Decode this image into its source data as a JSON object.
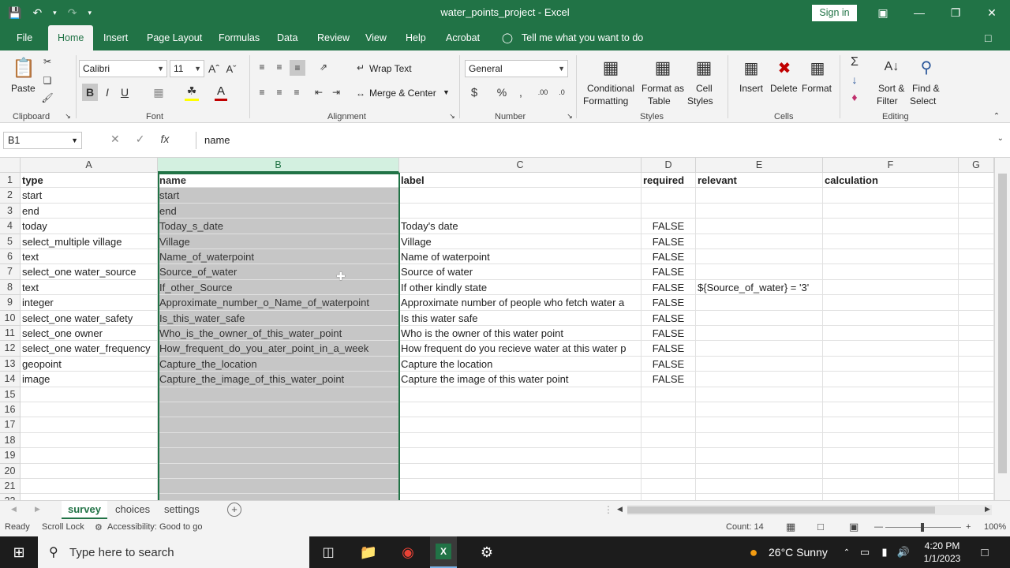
{
  "titlebar": {
    "document_title": "water_points_project  -  Excel",
    "sign_in": "Sign in"
  },
  "ribbon_tabs": [
    "File",
    "Home",
    "Insert",
    "Page Layout",
    "Formulas",
    "Data",
    "Review",
    "View",
    "Help",
    "Acrobat"
  ],
  "tell_me": "Tell me what you want to do",
  "ribbon": {
    "paste": "Paste",
    "font_name": "Calibri",
    "font_size": "11",
    "bold": "B",
    "italic": "I",
    "underline": "U",
    "wrap_text": "Wrap Text",
    "merge_center": "Merge & Center",
    "number_format": "General",
    "conditional_formatting": "Conditional",
    "conditional_formatting2": "Formatting",
    "format_as_table": "Format as",
    "format_as_table2": "Table",
    "cell_styles": "Cell",
    "cell_styles2": "Styles",
    "insert": "Insert",
    "delete": "Delete",
    "format": "Format",
    "sort_filter": "Sort &",
    "sort_filter2": "Filter",
    "find_select": "Find &",
    "find_select2": "Select",
    "groups": {
      "clipboard": "Clipboard",
      "font": "Font",
      "alignment": "Alignment",
      "number": "Number",
      "styles": "Styles",
      "cells": "Cells",
      "editing": "Editing"
    }
  },
  "formula_bar": {
    "name_box": "B1",
    "fx": "fx",
    "formula": "name"
  },
  "columns": [
    {
      "letter": "A"
    },
    {
      "letter": "B"
    },
    {
      "letter": "C"
    },
    {
      "letter": "D"
    },
    {
      "letter": "E"
    },
    {
      "letter": "F"
    },
    {
      "letter": "G"
    }
  ],
  "rows": [
    [
      "type",
      "name",
      "label",
      "required",
      "relevant",
      "calculation"
    ],
    [
      "start",
      "start",
      "",
      "",
      "",
      ""
    ],
    [
      "end",
      "end",
      "",
      "",
      "",
      ""
    ],
    [
      "today",
      "Today_s_date",
      "Today's date",
      "FALSE",
      "",
      ""
    ],
    [
      "select_multiple village",
      "Village",
      "Village",
      "FALSE",
      "",
      ""
    ],
    [
      "text",
      "Name_of_waterpoint",
      "Name of waterpoint",
      "FALSE",
      "",
      ""
    ],
    [
      "select_one water_source",
      "Source_of_water",
      "Source of water",
      "FALSE",
      "",
      ""
    ],
    [
      "text",
      "If_other_Source",
      "If other kindly state",
      "FALSE",
      "${Source_of_water} = '3'",
      ""
    ],
    [
      "integer",
      "Approximate_number_o_Name_of_waterpoint",
      "Approximate number of people who fetch water a",
      "FALSE",
      "",
      ""
    ],
    [
      "select_one water_safety",
      "Is_this_water_safe",
      "Is this water safe",
      "FALSE",
      "",
      ""
    ],
    [
      "select_one owner",
      "Who_is_the_owner_of_this_water_point",
      "Who is the owner of this water point",
      "FALSE",
      "",
      ""
    ],
    [
      "select_one water_frequency",
      "How_frequent_do_you_ater_point_in_a_week",
      "How frequent do you recieve water at this water p",
      "FALSE",
      "",
      ""
    ],
    [
      "geopoint",
      "Capture_the_location",
      "Capture the location",
      "FALSE",
      "",
      ""
    ],
    [
      "image",
      "Capture_the_image_of_this_water_point",
      "Capture the image of this water point",
      "FALSE",
      "",
      ""
    ],
    [
      "",
      "",
      "",
      "",
      "",
      ""
    ],
    [
      "",
      "",
      "",
      "",
      "",
      ""
    ],
    [
      "",
      "",
      "",
      "",
      "",
      ""
    ],
    [
      "",
      "",
      "",
      "",
      "",
      ""
    ],
    [
      "",
      "",
      "",
      "",
      "",
      ""
    ],
    [
      "",
      "",
      "",
      "",
      "",
      ""
    ],
    [
      "",
      "",
      "",
      "",
      "",
      ""
    ],
    [
      "",
      "",
      "",
      "",
      "",
      ""
    ]
  ],
  "sheets": [
    "survey",
    "choices",
    "settings"
  ],
  "status": {
    "ready": "Ready",
    "scroll_lock": "Scroll Lock",
    "accessibility": "Accessibility: Good to go",
    "count": "Count: 14",
    "zoom": "100%"
  },
  "taskbar": {
    "search_placeholder": "Type here to search",
    "weather": "26°C  Sunny",
    "time": "4:20 PM",
    "date": "1/1/2023"
  },
  "colors": {
    "excel_green": "#217346",
    "selection_fill": "#c6c6c6"
  }
}
